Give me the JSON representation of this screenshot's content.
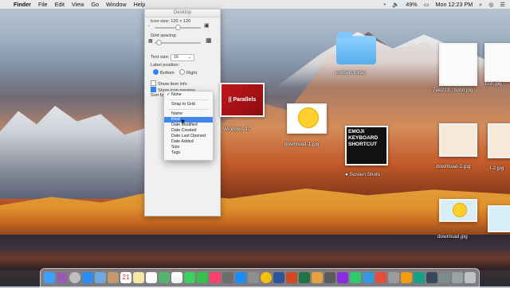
{
  "menubar": {
    "apple": "",
    "app": "Finder",
    "items": [
      "File",
      "Edit",
      "View",
      "Go",
      "Window",
      "Help"
    ],
    "battery": "49%",
    "clock": "Mon 12:23 PM"
  },
  "panel": {
    "title": "Desktop",
    "icon_size_label": "Icon size:",
    "icon_size_value": "120 × 120",
    "grid_spacing_label": "Grid spacing:",
    "text_size_label": "Text size:",
    "text_size_value": "16",
    "label_position_label": "Label position:",
    "bottom": "Bottom",
    "right": "Right",
    "show_item_info": "Show item info",
    "show_icon_preview": "Show icon preview",
    "sort_by_label": "Sort by:"
  },
  "sort_menu": {
    "items": [
      "None",
      "Snap to Grid",
      "Name",
      "Kind",
      "Date Modified",
      "Date Created",
      "Date Last Opened",
      "Date Added",
      "Size",
      "Tags"
    ],
    "checked": "None",
    "selected": "Kind"
  },
  "desktop": {
    "untitled_folder": "untitled folder",
    "windows10": "Windows 10",
    "parallels_text": "|| Parallels",
    "download1": "download-1.jpg",
    "emoji_card": "EMOJI KEYBOARD SHORTCUT",
    "screen_shots": "Screen Shots",
    "icon_file": "7ee213...ticon.jpg",
    "icon_file2": "con.jpg",
    "download2": "download-2.jpg",
    "download2_partial": "l-2.jpg",
    "download": "download.jpg"
  }
}
